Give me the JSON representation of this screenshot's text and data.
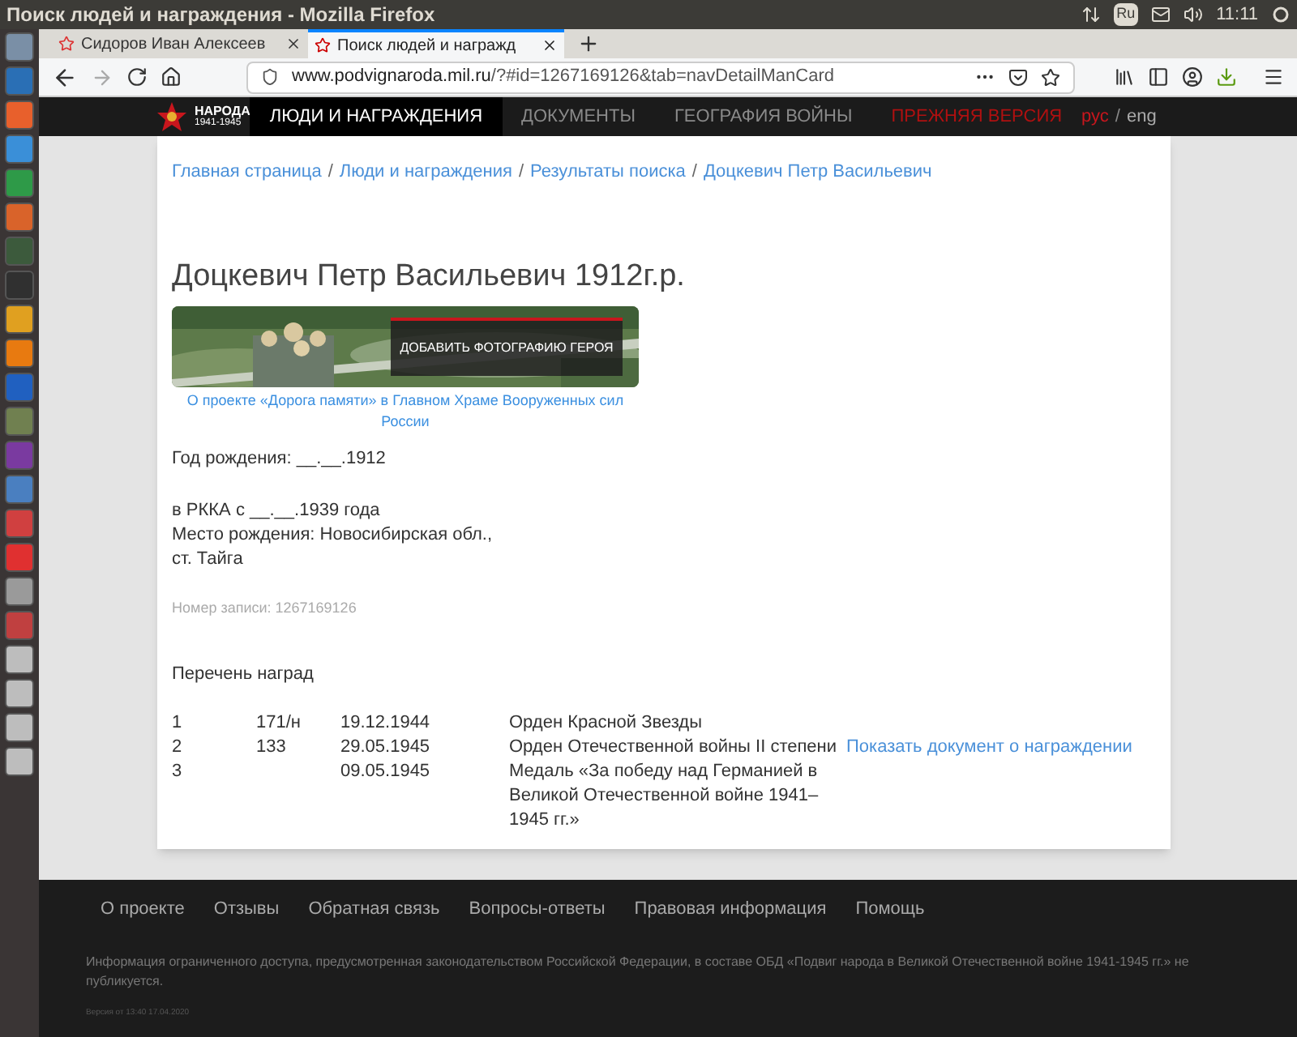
{
  "window": {
    "title": "Поиск людей и награждения - Mozilla Firefox"
  },
  "system_tray": {
    "keyboard": "Ru",
    "time": "11:11"
  },
  "tabs": [
    {
      "label": "Сидоров Иван Алексеев",
      "selected": false
    },
    {
      "label": "Поиск людей и награжд",
      "selected": true
    }
  ],
  "address_bar": {
    "host": "www.podvignaroda.mil.ru",
    "path": "/?#id=1267169126&tab=navDetailManCard"
  },
  "site_header": {
    "logo_lines": [
      "НАРОДА",
      "1941-1945"
    ],
    "nav": [
      {
        "label": "ЛЮДИ И НАГРАЖДЕНИЯ",
        "selected": true,
        "kind": "normal"
      },
      {
        "label": "ДОКУМЕНТЫ",
        "selected": false,
        "kind": "normal"
      },
      {
        "label": "ГЕОГРАФИЯ ВОЙНЫ",
        "selected": false,
        "kind": "normal"
      },
      {
        "label": "ПРЕЖНЯЯ ВЕРСИЯ",
        "selected": false,
        "kind": "alert"
      }
    ],
    "languages": [
      {
        "label": "рус",
        "selected": true
      },
      {
        "label": "eng",
        "selected": false
      }
    ],
    "separator": "/"
  },
  "breadcrumbs": [
    "Главная страница",
    "Люди и награждения",
    "Результаты поиска",
    "Доцкевич Петр Васильевич"
  ],
  "breadcrumb_separator": "/",
  "person": {
    "title": "Доцкевич Петр Васильевич 1912г.р.",
    "banner_button": "ДОБАВИТЬ ФОТОГРАФИЮ ГЕРОЯ",
    "banner_caption": "О проекте «Дорога памяти» в Главном Храме Вооруженных сил России",
    "birth_year": "Год рождения: __.__.1912",
    "details": [
      "в РККА с __.__.1939 года",
      "Место рождения: Новосибирская обл.,",
      "ст. Тайга"
    ],
    "record_number": "Номер записи: 1267169126"
  },
  "awards": {
    "title": "Перечень наград",
    "rows": [
      {
        "num": "1",
        "doc": "171/н",
        "date": "19.12.1944",
        "name": "Орден Красной Звезды"
      },
      {
        "num": "2",
        "doc": "133",
        "date": "29.05.1945",
        "name": "Орден Отечественной войны II степени",
        "link": "Показать документ о награждении"
      },
      {
        "num": "3",
        "date": "09.05.1945",
        "name": "Медаль «За победу над Германией в Великой Отечественной войне 1941–1945 гг.»"
      }
    ]
  },
  "footer": {
    "links": [
      "О проекте",
      "Отзывы",
      "Обратная связь",
      "Вопросы-ответы",
      "Правовая информация",
      "Помощь"
    ],
    "notice": "Информация ограниченного доступа, предусмотренная законодательством Российской Федерации, в составе ОБД «Подвиг народа в Великой Отечественной войне 1941-1945 гг.» не публикуется.",
    "version": "Версия от 13:40 17.04.2020"
  }
}
